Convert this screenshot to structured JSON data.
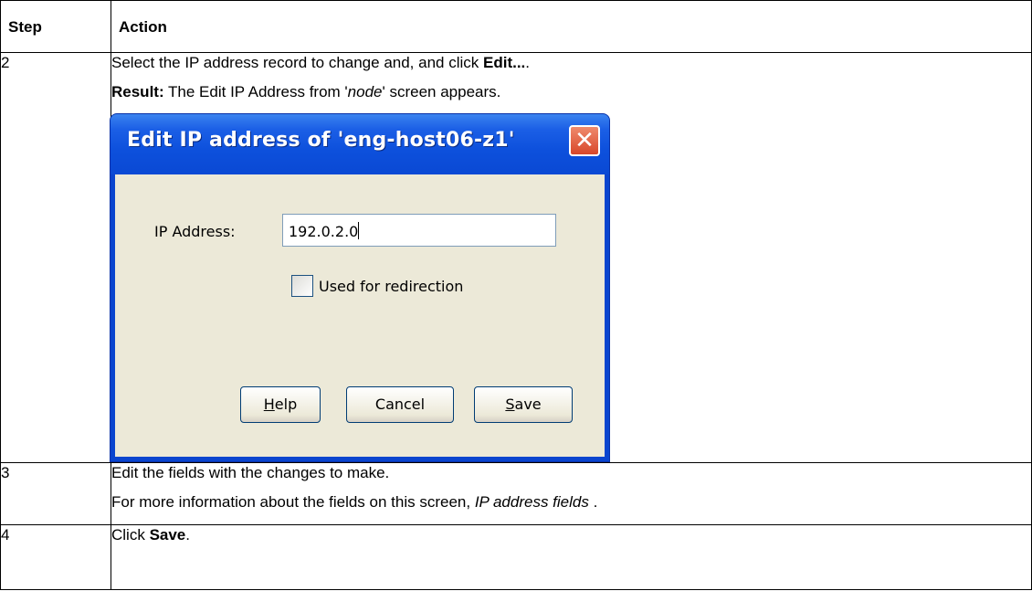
{
  "header": {
    "step": "Step",
    "action": "Action"
  },
  "rows": [
    {
      "step": "2",
      "line1_text": "Select the IP address record to change and, and click ",
      "line1_bold": "Edit...",
      "line1_end": ".",
      "line2_bold": "Result:",
      "line2_text1": " The Edit IP Address from '",
      "line2_italic": "node",
      "line2_text2": "' screen appears."
    },
    {
      "step": "3",
      "line1": "Edit the fields with the changes to make.",
      "line2_text": "For more information about the fields on this screen, ",
      "line2_italic": "IP address fields",
      "line2_end": " ."
    },
    {
      "step": "4",
      "line1_text": "Click ",
      "line1_bold": "Save",
      "line1_end": "."
    }
  ],
  "dialog": {
    "title": "Edit IP address of 'eng-host06-z1'",
    "close_glyph": "✕",
    "ip_label": "IP Address:",
    "ip_value": "192.0.2.0",
    "redirect_label": "Used for redirection",
    "redirect_checked": false,
    "help_mnemonic": "H",
    "help_rest": "elp",
    "cancel_label": "Cancel",
    "save_mnemonic": "S",
    "save_rest": "ave",
    "colors": {
      "titlebar": "#0d50dc",
      "client": "#ece9d8",
      "close": "#d8472a"
    }
  }
}
